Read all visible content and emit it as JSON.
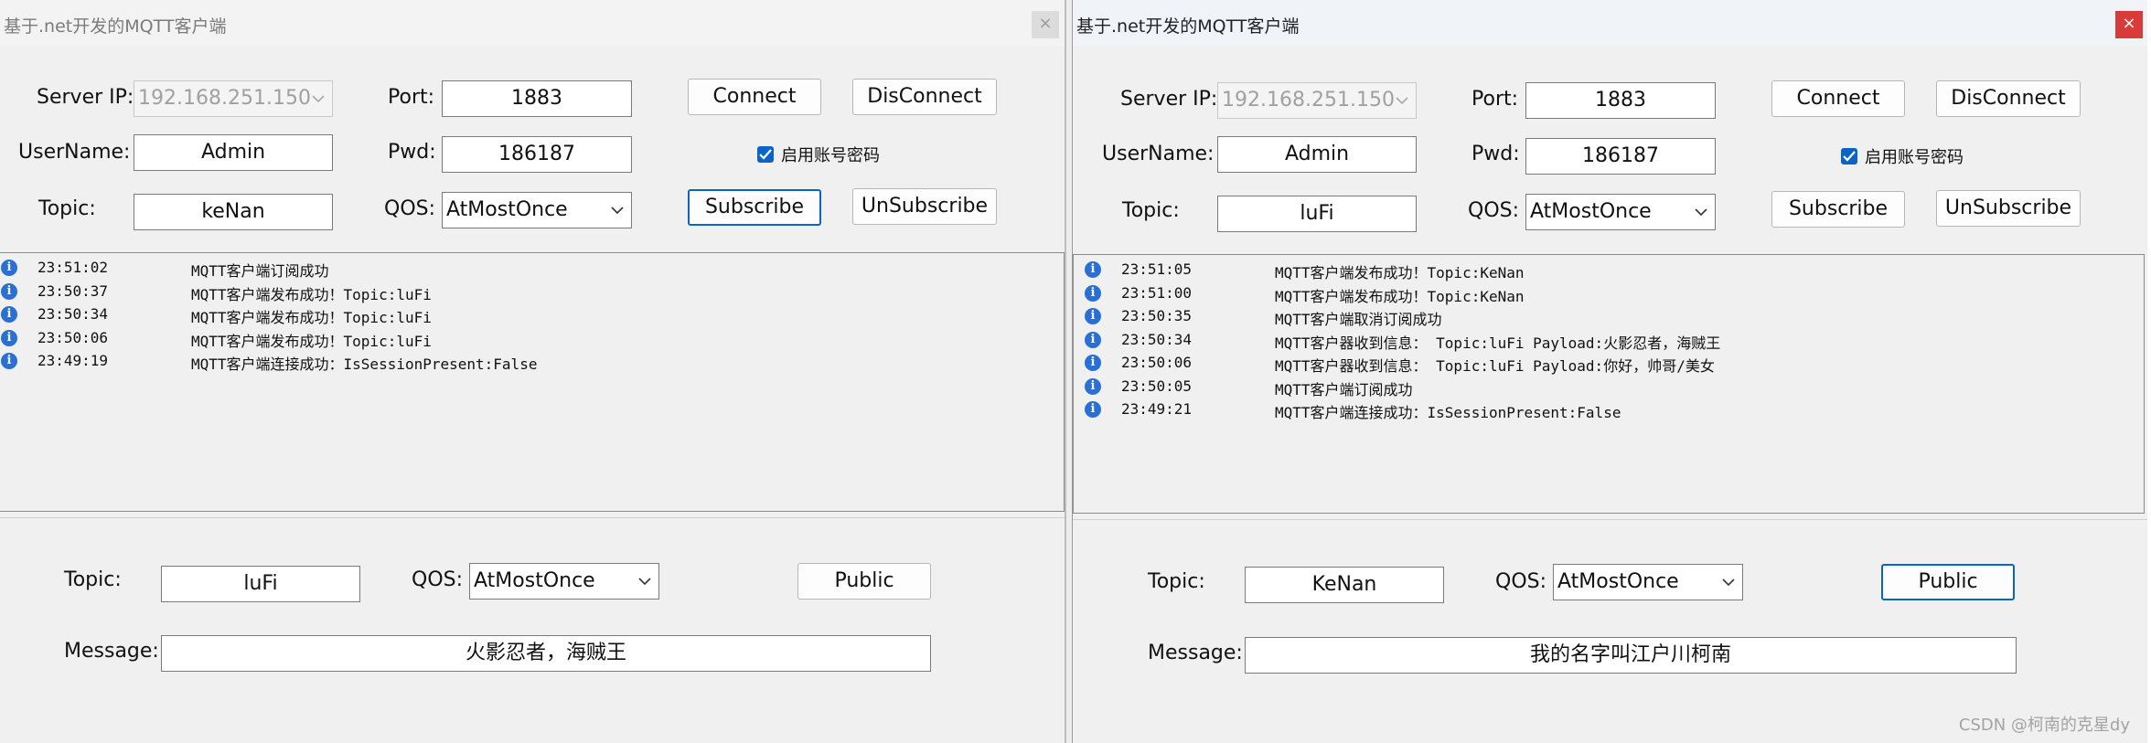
{
  "left": {
    "title": "基于.net开发的MQTT客户端",
    "close_glyph": "×",
    "server_ip_label": "Server IP:",
    "server_ip_value": "192.168.251.150",
    "port_label": "Port:",
    "port_value": "1883",
    "connect_label": "Connect",
    "disconnect_label": "DisConnect",
    "username_label": "UserName:",
    "username_value": "Admin",
    "pwd_label": "Pwd:",
    "pwd_value": "186187",
    "enable_auth_label": "启用账号密码",
    "enable_auth_checked": true,
    "topic_label": "Topic:",
    "topic_value": "keNan",
    "qos_label": "QOS:",
    "qos_value": "AtMostOnce",
    "subscribe_label": "Subscribe",
    "unsubscribe_label": "UnSubscribe",
    "logs": [
      {
        "time": "23:51:02",
        "message": "MQTT客户端订阅成功"
      },
      {
        "time": "23:50:37",
        "message": "MQTT客户端发布成功！Topic:luFi"
      },
      {
        "time": "23:50:34",
        "message": "MQTT客户端发布成功！Topic:luFi"
      },
      {
        "time": "23:50:06",
        "message": "MQTT客户端发布成功！Topic:luFi"
      },
      {
        "time": "23:49:19",
        "message": "MQTT客户端连接成功：IsSessionPresent:False"
      }
    ],
    "pub_topic_label": "Topic:",
    "pub_topic_value": "luFi",
    "pub_qos_label": "QOS:",
    "pub_qos_value": "AtMostOnce",
    "public_label": "Public",
    "message_label": "Message:",
    "message_value": "火影忍者，海贼王"
  },
  "right": {
    "title": "基于.net开发的MQTT客户端",
    "close_glyph": "×",
    "server_ip_label": "Server IP:",
    "server_ip_value": "192.168.251.150",
    "port_label": "Port:",
    "port_value": "1883",
    "connect_label": "Connect",
    "disconnect_label": "DisConnect",
    "username_label": "UserName:",
    "username_value": "Admin",
    "pwd_label": "Pwd:",
    "pwd_value": "186187",
    "enable_auth_label": "启用账号密码",
    "enable_auth_checked": true,
    "topic_label": "Topic:",
    "topic_value": "luFi",
    "qos_label": "QOS:",
    "qos_value": "AtMostOnce",
    "subscribe_label": "Subscribe",
    "unsubscribe_label": "UnSubscribe",
    "logs": [
      {
        "time": "23:51:05",
        "message": "MQTT客户端发布成功！Topic:KeNan"
      },
      {
        "time": "23:51:00",
        "message": "MQTT客户端发布成功！Topic:KeNan"
      },
      {
        "time": "23:50:35",
        "message": "MQTT客户端取消订阅成功"
      },
      {
        "time": "23:50:34",
        "message": "MQTT客户器收到信息： Topic:luFi Payload:火影忍者，海贼王"
      },
      {
        "time": "23:50:06",
        "message": "MQTT客户器收到信息： Topic:luFi Payload:你好，帅哥/美女"
      },
      {
        "time": "23:50:05",
        "message": "MQTT客户端订阅成功"
      },
      {
        "time": "23:49:21",
        "message": "MQTT客户端连接成功：IsSessionPresent:False"
      }
    ],
    "pub_topic_label": "Topic:",
    "pub_topic_value": "KeNan",
    "pub_qos_label": "QOS:",
    "pub_qos_value": "AtMostOnce",
    "public_label": "Public",
    "message_label": "Message:",
    "message_value": "我的名字叫江户川柯南"
  },
  "watermark": "CSDN @柯南的克星dy",
  "colors": {
    "accent_blue": "#0a64c8",
    "close_red": "#d93a3a",
    "info_icon": "#2a6fd4"
  }
}
